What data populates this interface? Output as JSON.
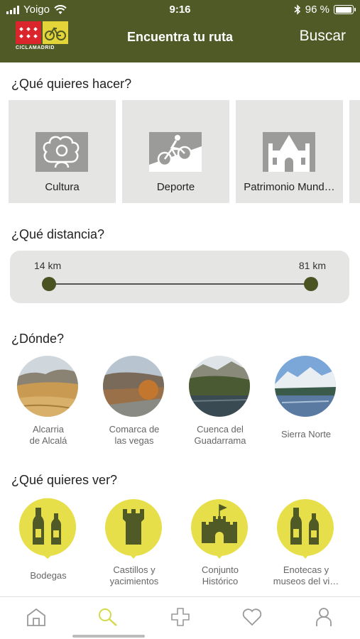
{
  "status_bar": {
    "carrier": "Yoigo",
    "time": "9:16",
    "battery_percent": "96 %",
    "battery_level": 0.96
  },
  "header": {
    "logo_text": "CICLAMADRID",
    "title": "Encuentra tu ruta",
    "search_label": "Buscar"
  },
  "activities": {
    "title": "¿Qué quieres hacer?",
    "items": [
      {
        "label": "Cultura",
        "icon": "culture-icon"
      },
      {
        "label": "Deporte",
        "icon": "cyclist-icon"
      },
      {
        "label": "Patrimonio Mund…",
        "icon": "heritage-icon"
      }
    ]
  },
  "distance": {
    "title": "¿Qué distancia?",
    "min_label": "14 km",
    "max_label": "81 km",
    "min_value": 14,
    "max_value": 81
  },
  "places": {
    "title": "¿Dónde?",
    "items": [
      {
        "label_line1": "Alcarria",
        "label_line2": "de Alcalá"
      },
      {
        "label_line1": "Comarca de",
        "label_line2": "las vegas"
      },
      {
        "label_line1": "Cuenca del",
        "label_line2": "Guadarrama"
      },
      {
        "label_line1": "Sierra Norte",
        "label_line2": ""
      }
    ]
  },
  "interests": {
    "title": "¿Qué quieres ver?",
    "items": [
      {
        "label_line1": "Bodegas",
        "label_line2": "",
        "icon": "wine-bottles-icon"
      },
      {
        "label_line1": "Castillos y",
        "label_line2": "yacimientos",
        "icon": "tower-icon"
      },
      {
        "label_line1": "Conjunto",
        "label_line2": "Histórico",
        "icon": "castle-icon"
      },
      {
        "label_line1": "Enotecas y",
        "label_line2": "museos del vi…",
        "icon": "wine-bottles-icon"
      }
    ]
  },
  "tab_bar": {
    "tabs": [
      "home-icon",
      "search-icon",
      "plus-icon",
      "heart-icon",
      "profile-icon"
    ],
    "active_index": 1
  },
  "colors": {
    "brand_green": "#4f5a26",
    "accent_yellow": "#e6df4a",
    "active_tab": "#d4d94a"
  }
}
